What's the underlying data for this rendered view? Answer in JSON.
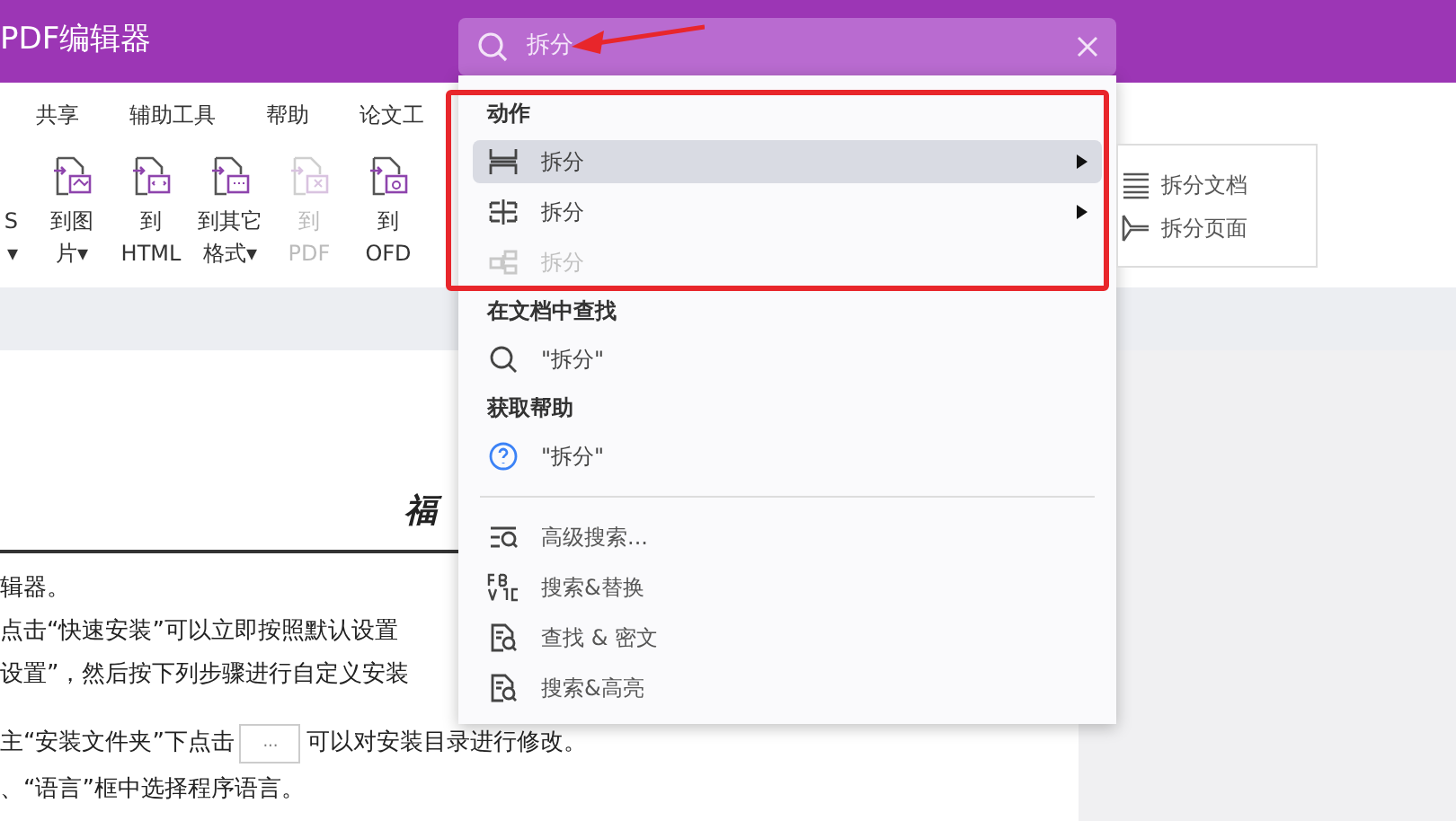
{
  "window": {
    "title": "PDF编辑器"
  },
  "search": {
    "value": "拆分"
  },
  "ribbon_tabs": [
    {
      "label": "共享"
    },
    {
      "label": "辅助工具"
    },
    {
      "label": "帮助"
    },
    {
      "label": "论文工"
    }
  ],
  "tools": [
    {
      "kind": "cut",
      "line1": "S",
      "caret": "▾",
      "disabled": false
    },
    {
      "kind": "image",
      "line1": "到图",
      "line2": "片",
      "caret": "▾",
      "disabled": false
    },
    {
      "kind": "html",
      "line1": "到",
      "line2": "HTML",
      "disabled": false
    },
    {
      "kind": "other",
      "line1": "到其它",
      "line2": "格式",
      "caret": "▾",
      "disabled": false
    },
    {
      "kind": "pdf",
      "line1": "到",
      "line2": "PDF",
      "disabled": true
    },
    {
      "kind": "ofd",
      "line1": "到",
      "line2": "OFD",
      "disabled": false
    }
  ],
  "document": {
    "heading": "福",
    "lines": [
      "辑器。",
      "点击“快速安装”可以立即按照默认设置",
      "设置”，然后按下列步骤进行自定义安装",
      "主“安装文件夹”下点击",
      "、“语言”框中选择程序语言。"
    ],
    "browse_button": "···",
    "line_tail": "可以对安装目录进行修改。"
  },
  "dropdown": {
    "sections": [
      {
        "header": "动作",
        "items": [
          {
            "kind": "split-h",
            "label": "拆分",
            "selected": true,
            "disabled": false,
            "submenu": true
          },
          {
            "kind": "split-grid",
            "label": "拆分",
            "selected": false,
            "disabled": false,
            "submenu": true
          },
          {
            "kind": "split-tree",
            "label": "拆分",
            "selected": false,
            "disabled": true,
            "submenu": false
          }
        ]
      },
      {
        "header": "在文档中查找",
        "items": [
          {
            "kind": "search",
            "label": "\"拆分\"",
            "selected": false,
            "disabled": false,
            "submenu": false
          }
        ]
      },
      {
        "header": "获取帮助",
        "items": [
          {
            "kind": "help",
            "label": "\"拆分\"",
            "selected": false,
            "disabled": false,
            "submenu": false
          }
        ]
      }
    ],
    "more": [
      {
        "kind": "advanced",
        "label": "高级搜索..."
      },
      {
        "kind": "replace",
        "label": "搜索&替换"
      },
      {
        "kind": "redact",
        "label": "查找 & 密文"
      },
      {
        "kind": "highlight",
        "label": "搜索&高亮"
      }
    ]
  },
  "submenu": [
    {
      "kind": "doc",
      "label": "拆分文档"
    },
    {
      "kind": "page",
      "label": "拆分页面"
    }
  ]
}
